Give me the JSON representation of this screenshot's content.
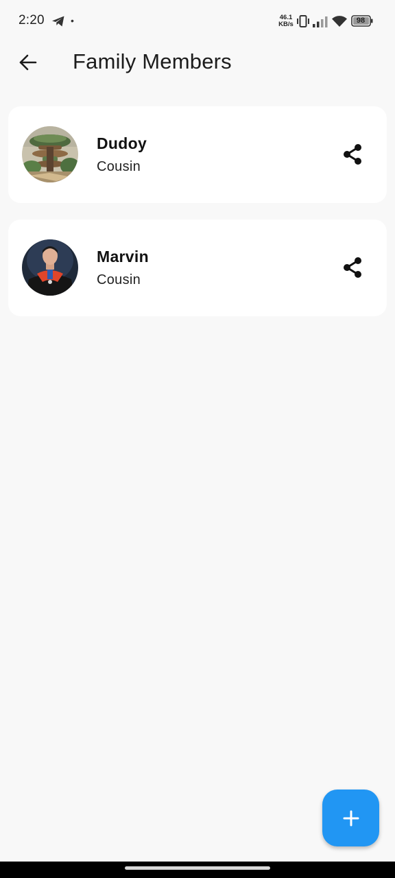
{
  "status_bar": {
    "time": "2:20",
    "dot": "•",
    "net_speed_value": "46.1",
    "net_speed_unit": "KB/s",
    "battery": "98",
    "icons": [
      "telegram-icon",
      "vibrate-icon",
      "signal-icon",
      "wifi-icon",
      "battery-icon"
    ]
  },
  "app_bar": {
    "back_icon": "arrow-left-icon",
    "title": "Family Members"
  },
  "members": [
    {
      "name": "Dudoy",
      "relation": "Cousin",
      "avatar": "tree-house-photo",
      "action_icon": "share-icon"
    },
    {
      "name": "Marvin",
      "relation": "Cousin",
      "avatar": "graduation-portrait-photo",
      "action_icon": "share-icon"
    }
  ],
  "fab": {
    "icon": "plus-icon",
    "color": "#2196f3"
  },
  "colors": {
    "background": "#f8f8f8",
    "card": "#ffffff",
    "accent": "#2196f3"
  }
}
